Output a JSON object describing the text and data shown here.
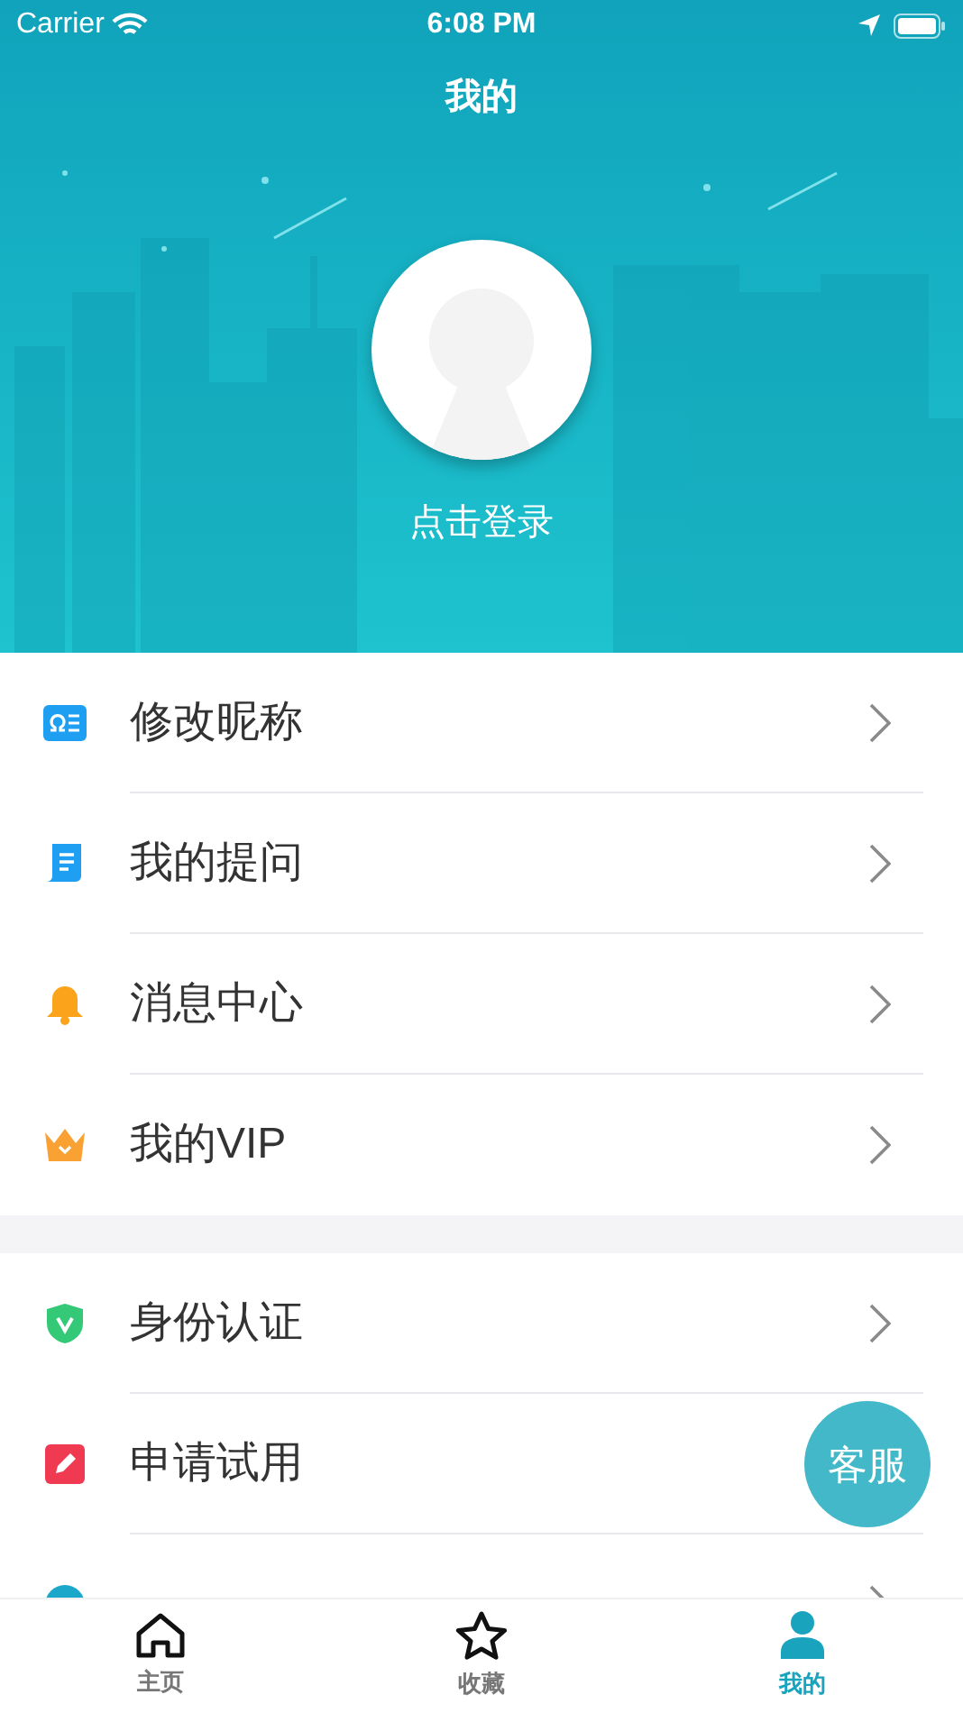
{
  "status_bar": {
    "carrier": "Carrier",
    "time": "6:08 PM"
  },
  "header": {
    "title": "我的",
    "login": "点击登录"
  },
  "menu_groups": [
    {
      "items": [
        {
          "kind": "card",
          "label": "修改昵称"
        },
        {
          "kind": "document",
          "label": "我的提问"
        },
        {
          "kind": "bell",
          "label": "消息中心"
        },
        {
          "kind": "crown",
          "label": "我的VIP"
        }
      ]
    },
    {
      "items": [
        {
          "kind": "shield",
          "label": "身份认证"
        },
        {
          "kind": "pencil",
          "label": "申请试用",
          "chevron_hidden": true
        },
        {
          "kind": "info"
        }
      ]
    }
  ],
  "float_button": "客服",
  "tab_bar": [
    {
      "kind": "home",
      "label": "主页",
      "selected": false
    },
    {
      "kind": "star",
      "label": "收藏",
      "selected": false
    },
    {
      "kind": "person",
      "label": "我的",
      "selected": true
    }
  ]
}
